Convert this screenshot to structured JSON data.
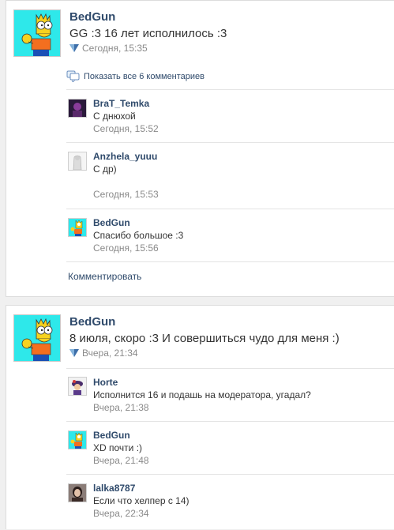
{
  "posts": [
    {
      "author": "BedGun",
      "status": "GG :3 16 лет исполнилось :3",
      "time": "Сегодня, 15:35",
      "show_all": "Показать все 6 комментариев",
      "comments": [
        {
          "author": "BraT_Temka",
          "text": "С днюхой",
          "time": "Сегодня, 15:52"
        },
        {
          "author": "Anzhela_yuuu",
          "text": "С др)",
          "time": "Сегодня, 15:53"
        },
        {
          "author": "BedGun",
          "text": "Спасибо большое :3",
          "time": "Сегодня, 15:56"
        }
      ],
      "add_comment": "Комментировать"
    },
    {
      "author": "BedGun",
      "status": "8 июля, скоро :3 И совершиться чудо для меня :)",
      "time": "Вчера, 21:34",
      "comments": [
        {
          "author": "Horte",
          "text": "Исполнится 16 и подашь на модератора, угадал?",
          "time": "Вчера, 21:38"
        },
        {
          "author": "BedGun",
          "text": "XD почти :)",
          "time": "Вчера, 21:48"
        },
        {
          "author": "lalka8787",
          "text": "Если что хелпер с 14)",
          "time": "Вчера, 22:34"
        }
      ]
    }
  ]
}
